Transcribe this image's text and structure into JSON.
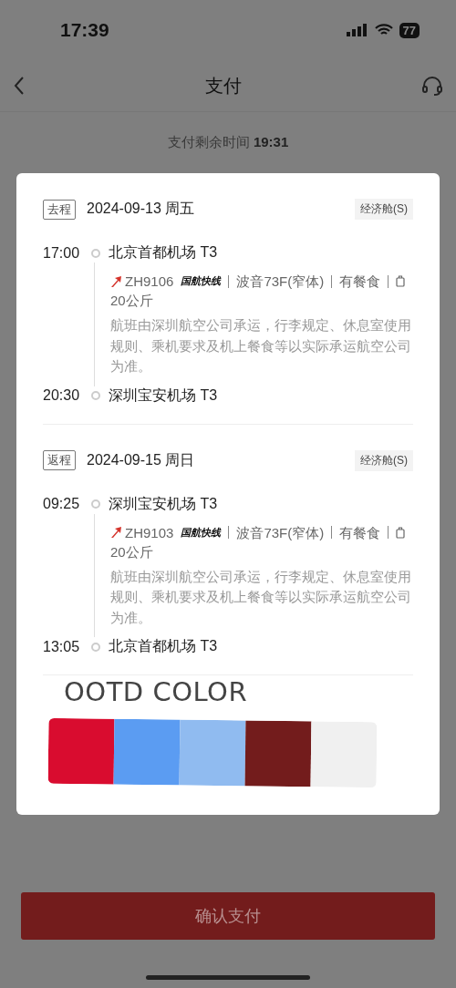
{
  "status_bar": {
    "time": "17:39",
    "battery": "77"
  },
  "nav": {
    "title": "支付"
  },
  "countdown": {
    "label": "支付剩余时间",
    "time": "19:31"
  },
  "segments": [
    {
      "tag": "去程",
      "date": "2024-09-13 周五",
      "cabin": "经济舱(S)",
      "depart": {
        "time": "17:00",
        "airport": "北京首都机场 T3"
      },
      "flight": "ZH9106",
      "brand": "国航快线",
      "aircraft": "波音73F(窄体)",
      "meal": "有餐食",
      "baggage": "20公斤",
      "note": "航班由深圳航空公司承运，行李规定、休息室使用规则、乘机要求及机上餐食等以实际承运航空公司为准。",
      "arrive": {
        "time": "20:30",
        "airport": "深圳宝安机场 T3"
      }
    },
    {
      "tag": "返程",
      "date": "2024-09-15 周日",
      "cabin": "经济舱(S)",
      "depart": {
        "time": "09:25",
        "airport": "深圳宝安机场 T3"
      },
      "flight": "ZH9103",
      "brand": "国航快线",
      "aircraft": "波音73F(窄体)",
      "meal": "有餐食",
      "baggage": "20公斤",
      "note": "航班由深圳航空公司承运，行李规定、休息室使用规则、乘机要求及机上餐食等以实际承运航空公司为准。",
      "arrive": {
        "time": "13:05",
        "airport": "北京首都机场 T3"
      }
    }
  ],
  "overlay": {
    "title": "OOTD COLOR",
    "swatches": [
      {
        "color": "#d90c2f"
      },
      {
        "color": "#5b9cf2"
      },
      {
        "color": "#90bbf0"
      },
      {
        "color": "#731c1c"
      },
      {
        "color": "#f0f0f0"
      }
    ]
  },
  "confirm_button": "确认支付"
}
